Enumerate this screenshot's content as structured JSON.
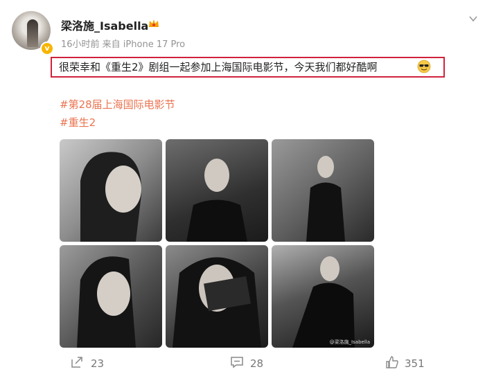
{
  "post": {
    "username": "梁洛施_Isabella",
    "meta": "16小时前  来自 iPhone 17 Pro",
    "verified_badge": "v",
    "text": "很荣幸和《重生2》剧组一起参加上海国际电影节，今天我们都好酷啊",
    "hashtags": [
      "#第28届上海国际电影节",
      "#重生2"
    ],
    "photo_watermark": "@梁洛施_Isabella"
  },
  "actions": {
    "reposts": "23",
    "comments": "28",
    "likes": "351"
  },
  "icons": [
    "avatar",
    "crown-icon",
    "chevron-down-icon",
    "sunglasses-emoji-icon",
    "repost-icon",
    "comment-icon",
    "like-icon"
  ],
  "colors": {
    "hashtag": "#eb7350",
    "highlight_box": "#d0223a",
    "verified": "#f7b500"
  }
}
